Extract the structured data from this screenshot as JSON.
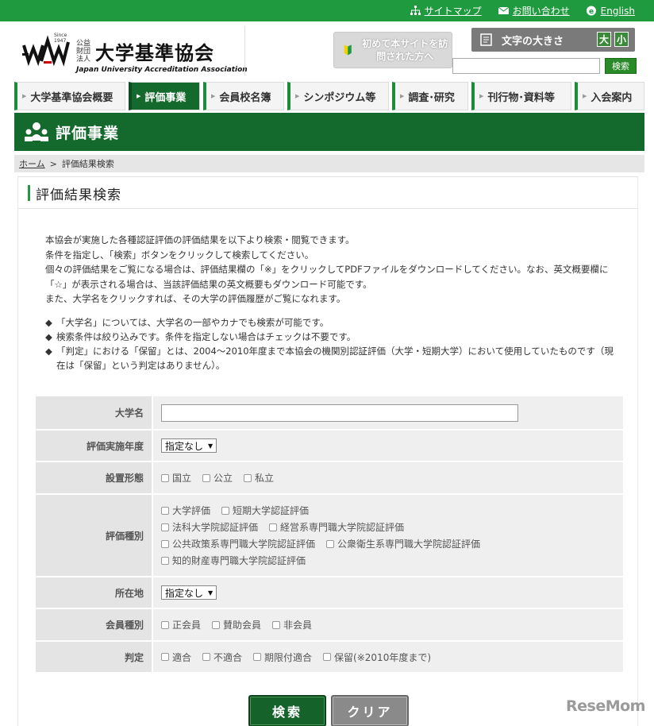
{
  "topbar": {
    "links": [
      {
        "label": "サイトマップ",
        "icon": "sitemap-icon"
      },
      {
        "label": "お問い合わせ",
        "icon": "mail-icon"
      },
      {
        "label": "English",
        "icon": "globe-e-icon"
      }
    ]
  },
  "logo": {
    "since": "Since 1947",
    "small": "公益財団法人",
    "name": "大学基準協会",
    "english": "Japan University Accreditation Association"
  },
  "header": {
    "first_time": "初めて本サイトを訪問された方へ",
    "font_size_label": "文字の大きさ",
    "font_large": "大",
    "font_small": "小",
    "search_button": "検索"
  },
  "nav": [
    {
      "label": "大学基準協会概要",
      "active": false
    },
    {
      "label": "評価事業",
      "active": true
    },
    {
      "label": "会員校名簿",
      "active": false
    },
    {
      "label": "シンポジウム等",
      "active": false
    },
    {
      "label": "調査･研究",
      "active": false
    },
    {
      "label": "刊行物･資料等",
      "active": false
    },
    {
      "label": "入会案内",
      "active": false
    }
  ],
  "section": {
    "title": "評価事業"
  },
  "breadcrumb": {
    "home": "ホーム",
    "separator": ">",
    "current": "評価結果検索"
  },
  "page": {
    "title": "評価結果検索",
    "intro": [
      "本協会が実施した各種認証評価の評価結果を以下より検索・閲覧できます。",
      "条件を指定し、「検索」ボタンをクリックして検索してください。",
      "個々の評価結果をご覧になる場合は、評価結果欄の「※」をクリックしてPDFファイルをダウンロードしてください。なお、英文概要欄に「☆」が表示される場合は、当該評価結果の英文概要もダウンロード可能です。",
      "また、大学名をクリックすれば、その大学の評価履歴がご覧になれます。"
    ],
    "notes": [
      "「大学名」については、大学名の一部やカナでも検索が可能です。",
      "検索条件は絞り込みです。条件を指定しない場合はチェックは不要です。",
      "「判定」における「保留」とは、2004～2010年度まで本協会の機関別認証評価（大学・短期大学）において使用していたものです（現在は「保留」という判定はありません）。"
    ]
  },
  "form": {
    "university_label": "大学名",
    "year_label": "評価実施年度",
    "year_value": "指定なし",
    "establish_label": "設置形態",
    "establish_options": [
      "国立",
      "公立",
      "私立"
    ],
    "type_label": "評価種別",
    "type_options": [
      [
        "大学評価",
        "短期大学認証評価"
      ],
      [
        "法科大学院認証評価",
        "経営系専門職大学院認証評価"
      ],
      [
        "公共政策系専門職大学院認証評価",
        "公衆衛生系専門職大学院認証評価"
      ],
      [
        "知的財産専門職大学院認証評価"
      ]
    ],
    "location_label": "所在地",
    "location_value": "指定なし",
    "member_label": "会員種別",
    "member_options": [
      "正会員",
      "賛助会員",
      "非会員"
    ],
    "judgment_label": "判定",
    "judgment_options": [
      "適合",
      "不適合",
      "期限付適合",
      "保留(※2010年度まで)"
    ]
  },
  "buttons": {
    "search": "検索",
    "clear": "クリア"
  },
  "watermark": "ReseMom",
  "colors": {
    "primary_green": "#1f9a3e",
    "dark_green": "#14692c"
  }
}
